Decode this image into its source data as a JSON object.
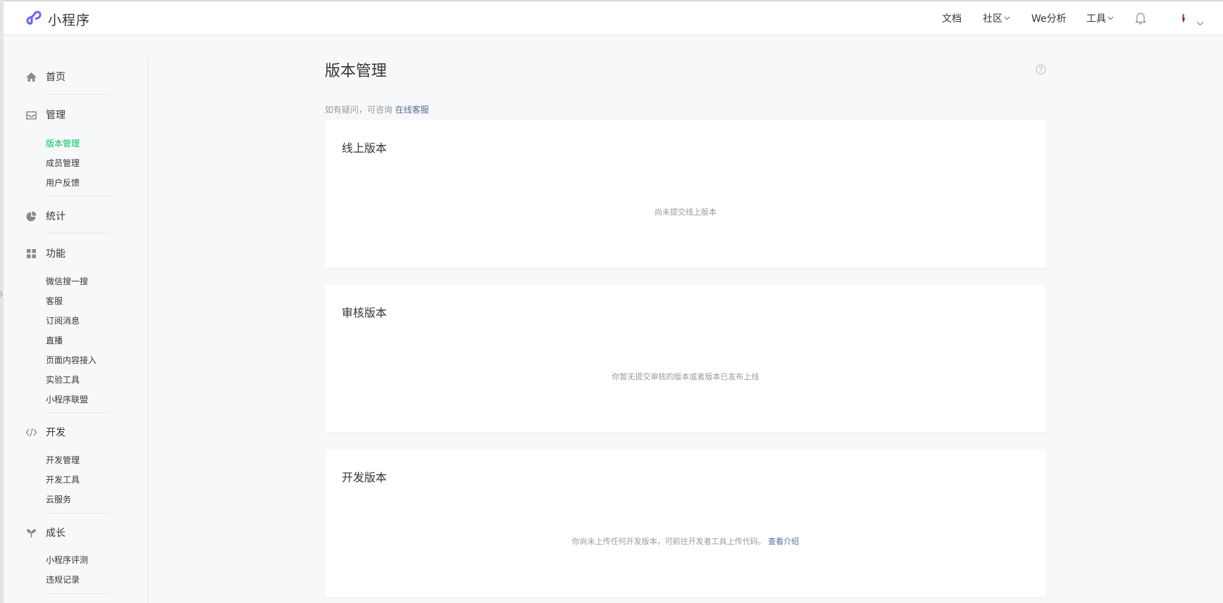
{
  "header": {
    "logo_text": "小程序",
    "nav": {
      "docs": "文档",
      "community": "社区",
      "analytics": "We分析",
      "tools": "工具"
    }
  },
  "sidebar": {
    "home": "首页",
    "manage": "管理",
    "manage_items": [
      "版本管理",
      "成员管理",
      "用户反馈"
    ],
    "stats": "统计",
    "features": "功能",
    "feature_items": [
      "微信搜一搜",
      "客服",
      "订阅消息",
      "直播",
      "页面内容接入",
      "实验工具",
      "小程序联盟"
    ],
    "develop": "开发",
    "develop_items": [
      "开发管理",
      "开发工具",
      "云服务"
    ],
    "growth": "成长",
    "growth_items": [
      "小程序评测",
      "违规记录"
    ]
  },
  "main": {
    "title": "版本管理",
    "consult_text": "如有疑问，可咨询 ",
    "consult_link": "在线客服",
    "cards": {
      "online": {
        "title": "线上版本",
        "empty": "尚未提交线上版本"
      },
      "review": {
        "title": "审核版本",
        "empty": "你暂无提交审核的版本或者版本已发布上线"
      },
      "dev": {
        "title": "开发版本",
        "empty": "你尚未上传任何开发版本，可前往开发者工具上传代码。",
        "link": "查看介绍"
      }
    }
  },
  "colors": {
    "active": "#07c160",
    "link": "#576b95",
    "logo": "#6467f0"
  }
}
